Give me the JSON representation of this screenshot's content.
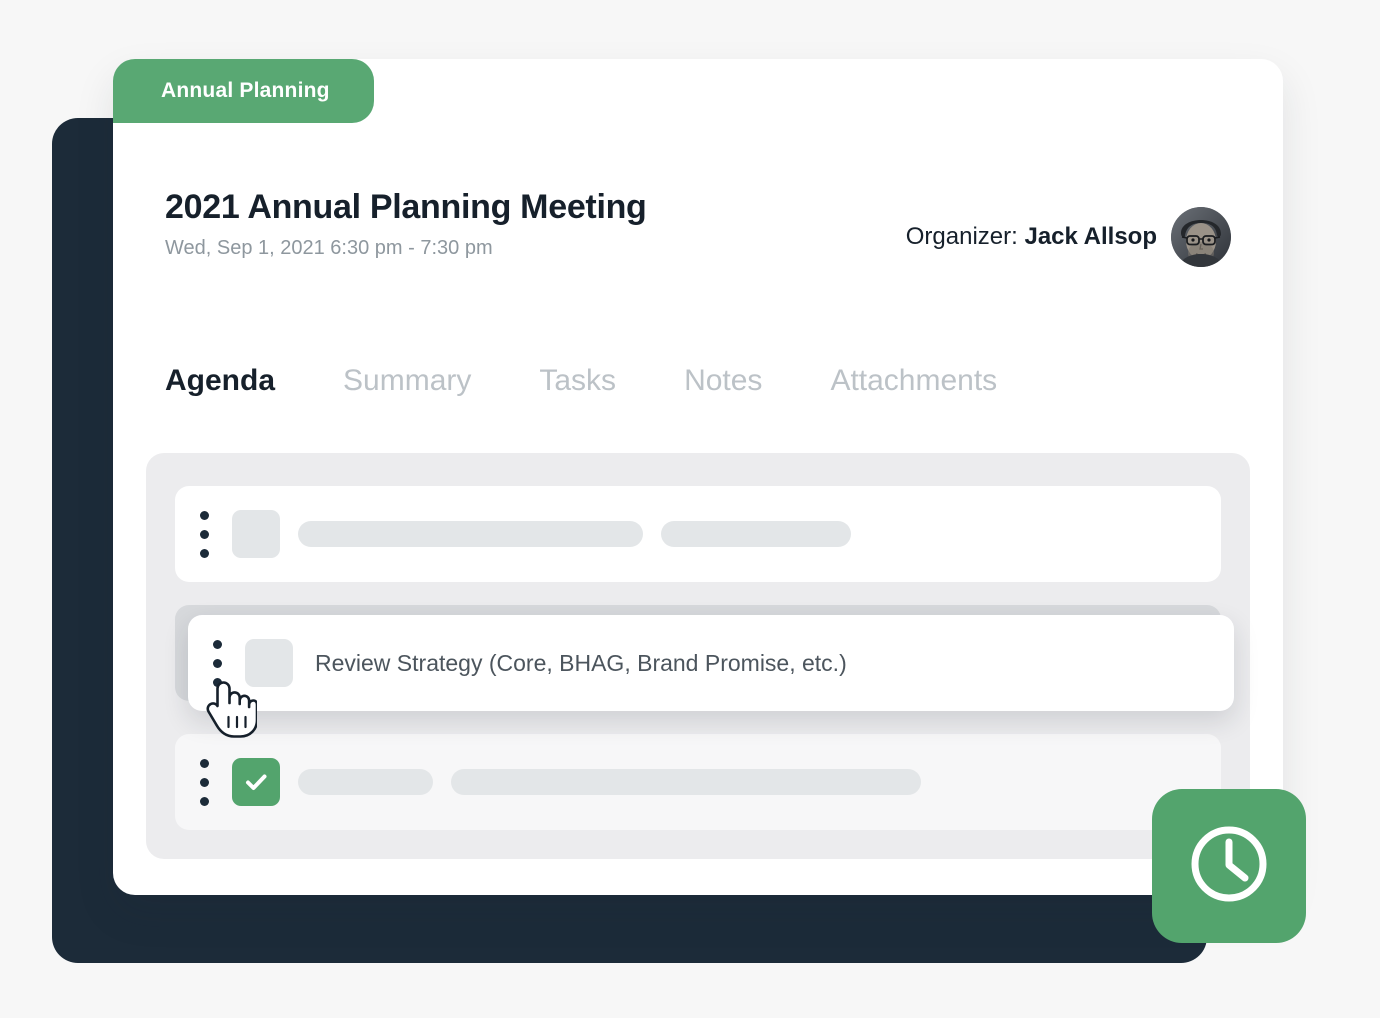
{
  "category_tab": {
    "label": "Annual Planning"
  },
  "header": {
    "title": "2021 Annual Planning Meeting",
    "datetime": "Wed, Sep 1, 2021 6:30 pm - 7:30 pm",
    "organizer_label": "Organizer:",
    "organizer_name": "Jack Allsop",
    "avatar_alt": "avatar"
  },
  "tabs": [
    {
      "label": "Agenda",
      "active": true
    },
    {
      "label": "Summary",
      "active": false
    },
    {
      "label": "Tasks",
      "active": false
    },
    {
      "label": "Notes",
      "active": false
    },
    {
      "label": "Attachments",
      "active": false
    }
  ],
  "agenda": {
    "rows": [
      {
        "id": "row-1",
        "state": "idle",
        "checked": false,
        "text": "",
        "bars": [
          345,
          190
        ]
      },
      {
        "id": "row-2",
        "state": "dragging",
        "checked": false,
        "text": "Review Strategy (Core, BHAG, Brand Promise, etc.)",
        "bars": []
      },
      {
        "id": "row-3",
        "state": "idle",
        "checked": true,
        "text": "",
        "bars": [
          135,
          470
        ]
      }
    ]
  },
  "fab": {
    "icon": "clock-icon"
  },
  "cursor": {
    "icon": "grab-hand-cursor"
  },
  "colors": {
    "accent_green": "#53a46d",
    "tab_green": "#59a873",
    "backdrop_navy": "#1c2b39",
    "page_bg": "#f7f7f7",
    "skeleton_gray": "#e3e6e8",
    "agenda_panel_gray": "#ececee",
    "drop_placeholder_gray": "#d7d9dc",
    "title_dark": "#16202b",
    "muted_text": "#8e979e",
    "tab_inactive": "#bcc2c7"
  }
}
